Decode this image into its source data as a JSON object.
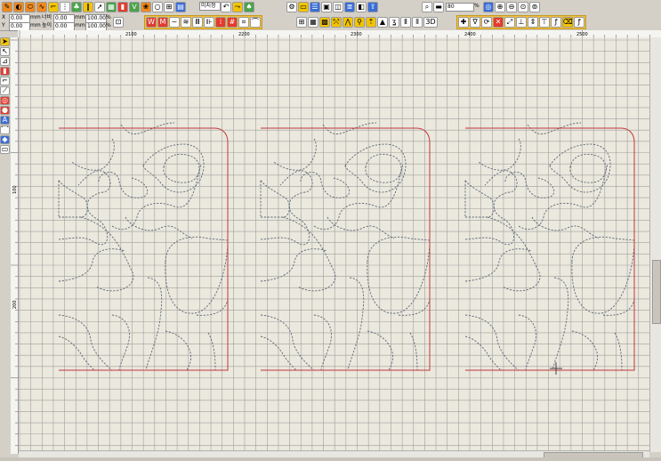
{
  "toolbar_top": {
    "zoom_value": "80",
    "zoom_unit": "%"
  },
  "toolbar_second": {
    "x_label": "X",
    "x_value": "0.00",
    "x_unit": "mm",
    "y_label": "Y",
    "y_value": "0.00",
    "y_unit": "mm",
    "width_label": "너비",
    "width_value": "0.00",
    "width_unit": "mm",
    "height_label": "높이",
    "height_value": "0.00",
    "height_unit": "mm",
    "scale_w_value": "100.00",
    "scale_w_unit": "%",
    "scale_h_value": "100.00",
    "scale_h_unit": "%",
    "stitch_type_value": "미지정",
    "button_3d_label": "3D"
  },
  "left_tools": {
    "text_tool_label": "A"
  },
  "ruler_top": {
    "ticks": [
      "2100",
      "2200",
      "2300",
      "2400",
      "2500"
    ]
  },
  "ruler_left": {
    "ticks": [
      "100",
      "200"
    ]
  },
  "colors": {
    "canvas_bg": "#ebe8dd",
    "grid_line": "#9ea0a0",
    "frame_line": "#c0393b",
    "stitch_line": "#5a6876"
  }
}
